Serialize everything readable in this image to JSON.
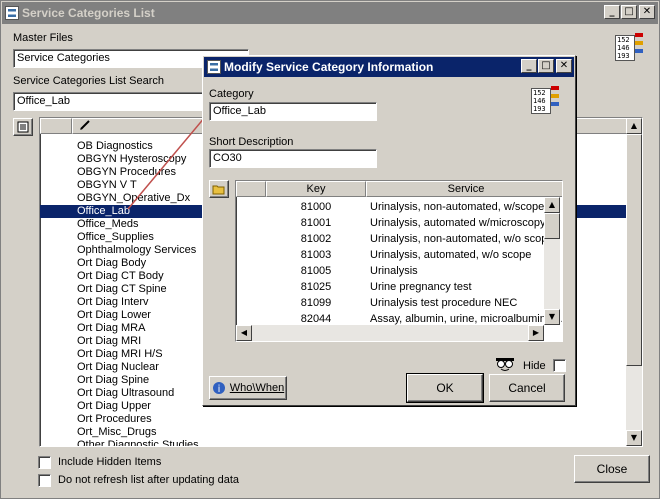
{
  "main_window": {
    "title": "Service Categories List",
    "master_files_label": "Master Files",
    "master_files_value": "Service Categories",
    "search_label": "Service Categories List Search",
    "search_value": "Office_Lab",
    "categories": [
      "OB Diagnostics",
      "OBGYN Hysteroscopy",
      "OBGYN Procedures",
      "OBGYN V T",
      "OBGYN_Operative_Dx",
      "Office_Lab",
      "Office_Meds",
      "Office_Supplies",
      "Ophthalmology Services",
      "Ort Diag Body",
      "Ort Diag CT Body",
      "Ort Diag CT Spine",
      "Ort Diag Interv",
      "Ort Diag Lower",
      "Ort Diag MRA",
      "Ort Diag MRI",
      "Ort Diag MRI H/S",
      "Ort Diag Nuclear",
      "Ort Diag Spine",
      "Ort Diag Ultrasound",
      "Ort Diag Upper",
      "Ort Procedures",
      "Ort_Misc_Drugs",
      "Other Diagnostic Studies"
    ],
    "selected_category": "Office_Lab",
    "include_hidden_label": "Include Hidden Items",
    "no_refresh_label": "Do not refresh list after updating data",
    "close_label": "Close",
    "icon_numbers": [
      "152",
      "146",
      "193"
    ]
  },
  "dialog": {
    "title": "Modify Service Category Information",
    "category_label": "Category",
    "category_value": "Office_Lab",
    "short_desc_label": "Short Description",
    "short_desc_value": "CO30",
    "columns": {
      "key": "Key",
      "service": "Service"
    },
    "services": [
      {
        "key": "81000",
        "service": "Urinalysis, non-automated, w/scope",
        "checked": true
      },
      {
        "key": "81001",
        "service": "Urinalysis, automated w/microscopy",
        "checked": true
      },
      {
        "key": "81002",
        "service": "Urinalysis, non-automated, w/o scope",
        "checked": true
      },
      {
        "key": "81003",
        "service": "Urinalysis, automated, w/o scope",
        "checked": true
      },
      {
        "key": "81005",
        "service": "Urinalysis",
        "checked": true
      },
      {
        "key": "81025",
        "service": "Urine pregnancy test",
        "checked": true
      },
      {
        "key": "81099",
        "service": "Urinalysis test procedure NEC",
        "checked": true
      },
      {
        "key": "82044",
        "service": "Assay,  albumin, urine,  microalbumin,  s...",
        "checked": true
      }
    ],
    "hide_label": "Hide",
    "who_when_label": "Who\\When",
    "ok_label": "OK",
    "cancel_label": "Cancel",
    "icon_numbers": [
      "152",
      "146",
      "193"
    ]
  },
  "colors": {
    "window_bg": "#d4d0c8",
    "active_title": "#0a246a",
    "inactive_title": "#808080",
    "selection": "#0a246a",
    "check": "#1a9a1a",
    "connector_arrow": "#c0504d"
  }
}
